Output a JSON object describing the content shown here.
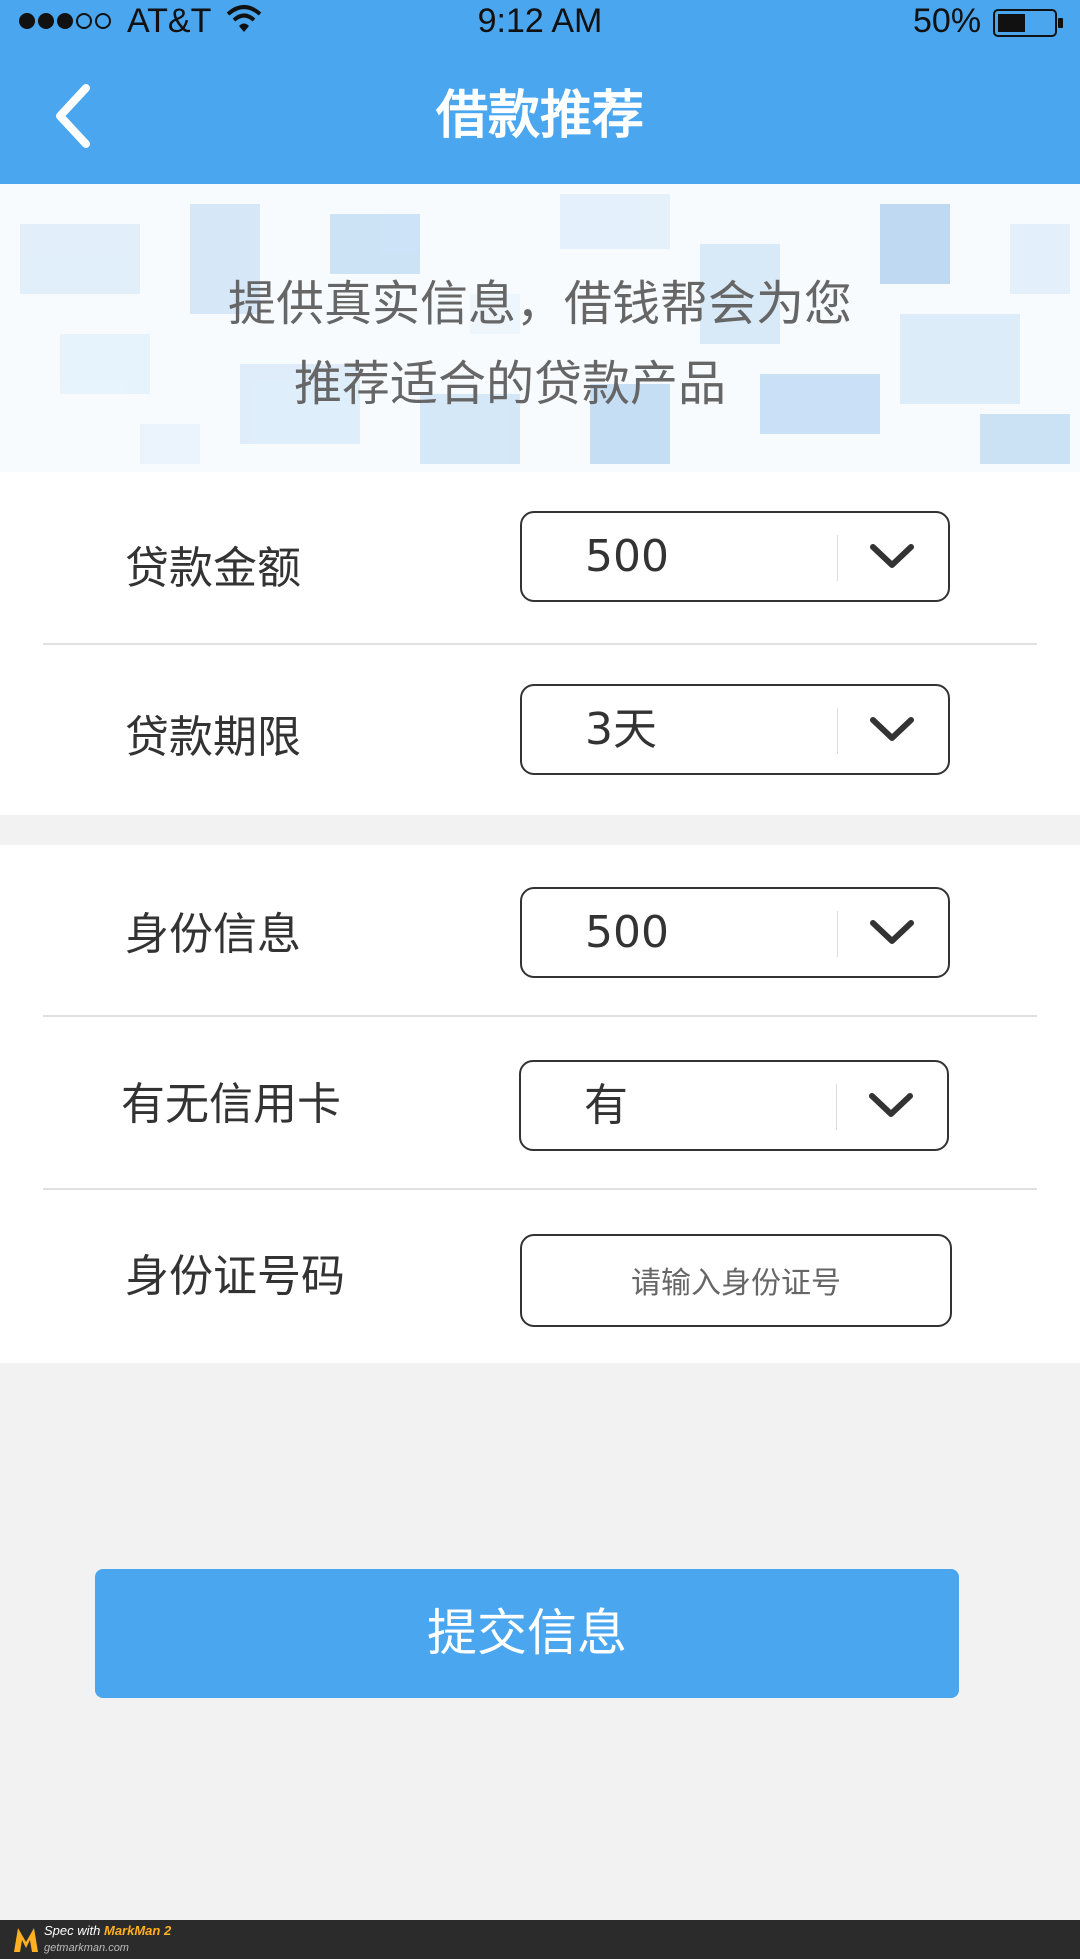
{
  "status_bar": {
    "carrier": "AT&T",
    "time": "9:12 AM",
    "battery_pct": "50%",
    "battery_level": 0.5
  },
  "header": {
    "title": "借款推荐"
  },
  "banner": {
    "line1": "提供真实信息，借钱帮会为您",
    "line2": "推荐适合的贷款产品"
  },
  "form": {
    "loan_amount": {
      "label": "贷款金额",
      "value": "500"
    },
    "loan_term": {
      "label": "贷款期限",
      "value": "3天"
    },
    "identity": {
      "label": "身份信息",
      "value": "500"
    },
    "credit_card": {
      "label": "有无信用卡",
      "value": "有"
    },
    "id_number": {
      "label": "身份证号码",
      "placeholder": "请输入身份证号"
    }
  },
  "submit": {
    "label": "提交信息"
  },
  "footer": {
    "brand": "Spec with",
    "product": "MarkMan 2",
    "site": "getmarkman.com"
  },
  "colors": {
    "primary": "#4aa6ee",
    "text": "#333333",
    "placeholder": "#666666",
    "divider": "#e0e0e0",
    "select_divider": "#dcdcdc",
    "page_bg": "#f2f2f2"
  }
}
